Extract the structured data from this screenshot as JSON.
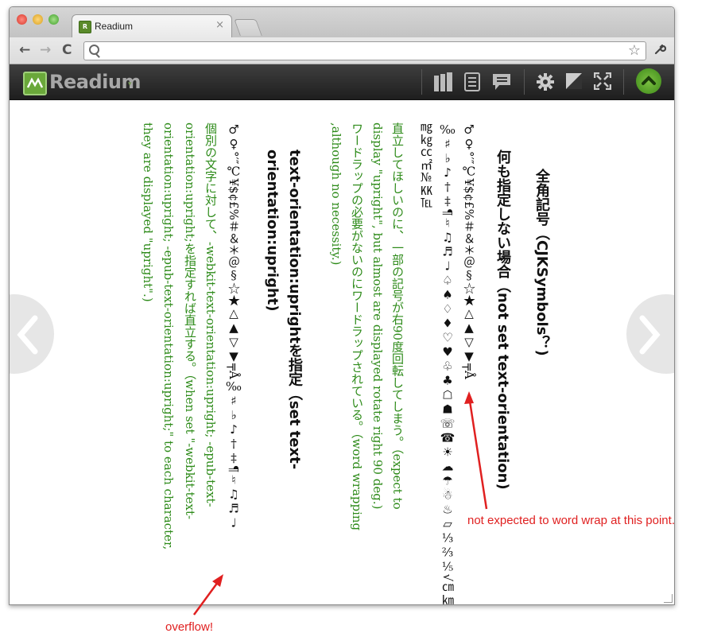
{
  "browser": {
    "tab_title": "Readium",
    "tab_close": "×",
    "back": "←",
    "forward": "→",
    "reload": "C",
    "url": "",
    "bookmark_star": "☆",
    "wrench": "🔧"
  },
  "appbar": {
    "logo_text": "Readium",
    "logo_caret": "▾",
    "icons": [
      "library-icon",
      "toc-icon",
      "notes-icon",
      "settings-icon",
      "contrast-icon",
      "fullscreen-icon",
      "scroll-top-icon"
    ]
  },
  "content": {
    "heading1": "全角記号（CJKSymbols？)",
    "heading2": "何も指定しない場合（not set text-orientation)",
    "symbols_line1": "♂♀°′″℃¥$¢£%＃＆＊＠§☆★△▲▽▼╤Å",
    "symbols_line2": "‰♯♭♪†‡¶♮♫♬♩♤♠♢♦♡♥♧♣☖☗☏☎☀☁☂☃♨▱⅓⅔⅕√㎝㎞",
    "symbols_line3": "㎎㎏㏄㎡№㏍℡",
    "green1": "直立してほしいのに、一部の記号が右90度回転してしまう。（expect to",
    "green2": "display \"upright\", but almost are displayed rotate right 90 deg.)",
    "green3": "ワードラップの必要がないのにワードラップされている。（word wrapping",
    "green4": ",although no necessity.)",
    "heading3a": "text-orientation:uprightを指定（set text-",
    "heading3b": "orientation:upright)",
    "symbols_line4": "♂♀°′″℃¥$¢£%＃＆＊＠§☆★△▲▽▼╤Å‰♯♭♪†‡¶♮♫♬♩",
    "green5": "個別の文字に対して、-webkit-text-orientation:upright; -epub-text-",
    "green6": "orientation:upright;を指定すれば直立する。（when set \"-webkit-text-",
    "green7": "orientation:upright; -epub-text-orientation:upright;\" to each character,",
    "green8": "they are displayed \"upright\".)"
  },
  "annotations": {
    "not_expected": "not expected to  word wrap at this point.",
    "overflow": "overflow!",
    "color": "#e02020"
  },
  "nav": {
    "prev_glyph": "‹",
    "next_glyph": "›"
  }
}
